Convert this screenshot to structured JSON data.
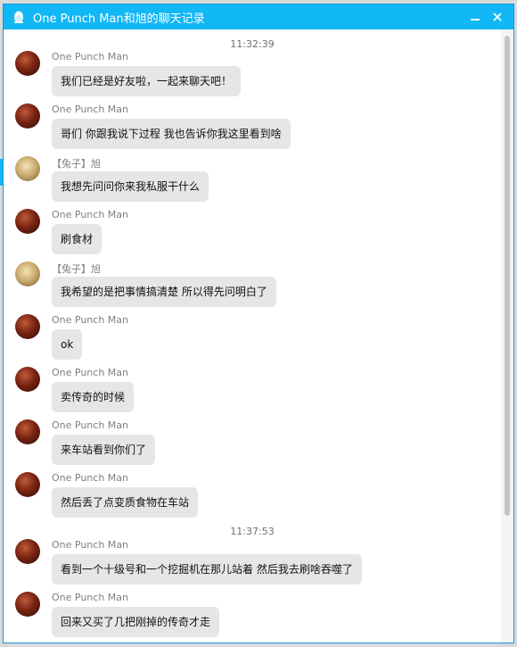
{
  "window": {
    "title": "One Punch Man和旭的聊天记录",
    "accent_color": "#12b7f5",
    "icons": {
      "app": "penguin-icon",
      "minimize": "minimize-icon",
      "close": "close-icon"
    }
  },
  "timestamps": [
    "11:32:39",
    "11:37:53"
  ],
  "messages": [
    {
      "sender": "One Punch Man",
      "avatar": "one-punch-man-avatar",
      "text": "我们已经是好友啦，一起来聊天吧！"
    },
    {
      "sender": "One Punch Man",
      "avatar": "one-punch-man-avatar",
      "text": "哥们  你跟我说下过程 我也告诉你我这里看到啥"
    },
    {
      "sender": "【兔子】旭",
      "avatar": "rabbit-avatar",
      "text": "我想先问问你来我私服干什么"
    },
    {
      "sender": "One Punch Man",
      "avatar": "one-punch-man-avatar",
      "text": "刷食材"
    },
    {
      "sender": "【兔子】旭",
      "avatar": "rabbit-avatar",
      "text": "我希望的是把事情搞清楚  所以得先问明白了"
    },
    {
      "sender": "One Punch Man",
      "avatar": "one-punch-man-avatar",
      "text": "ok"
    },
    {
      "sender": "One Punch Man",
      "avatar": "one-punch-man-avatar",
      "text": "卖传奇的时候"
    },
    {
      "sender": "One Punch Man",
      "avatar": "one-punch-man-avatar",
      "text": "来车站看到你们了"
    },
    {
      "sender": "One Punch Man",
      "avatar": "one-punch-man-avatar",
      "text": "然后丢了点变质食物在车站"
    },
    {
      "sender": "One Punch Man",
      "avatar": "one-punch-man-avatar",
      "text": "看到一个十级号和一个挖掘机在那儿站着 然后我去刷啥吞噬了"
    },
    {
      "sender": "One Punch Man",
      "avatar": "one-punch-man-avatar",
      "text": "回来又买了几把刚掉的传奇才走"
    }
  ]
}
